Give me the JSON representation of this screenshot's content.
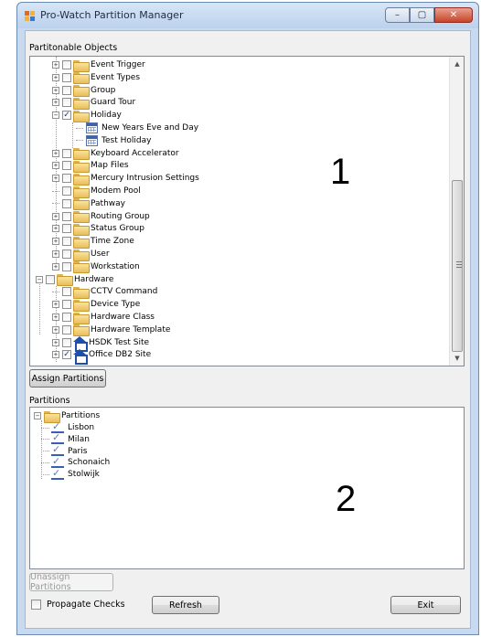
{
  "window": {
    "title": "Pro-Watch Partition Manager",
    "buttons": {
      "minimize": "–",
      "maximize": "▢",
      "close": "✕"
    }
  },
  "objects_panel": {
    "label": "Partitonable Objects",
    "items": [
      {
        "label": "Event Trigger",
        "expander": "+",
        "checked": false,
        "icon": "folder-icon"
      },
      {
        "label": "Event Types",
        "expander": "+",
        "checked": false,
        "icon": "folder-icon"
      },
      {
        "label": "Group",
        "expander": "+",
        "checked": false,
        "icon": "folder-icon"
      },
      {
        "label": "Guard Tour",
        "expander": "+",
        "checked": false,
        "icon": "folder-icon"
      },
      {
        "label": "Holiday",
        "expander": "−",
        "checked": true,
        "icon": "folder-icon"
      },
      {
        "label": "New Years Eve and Day",
        "expander": "",
        "checked": false,
        "icon": "calendar-icon"
      },
      {
        "label": "Test Holiday",
        "expander": "",
        "checked": false,
        "icon": "calendar-icon"
      },
      {
        "label": "Keyboard Accelerator",
        "expander": "+",
        "checked": false,
        "icon": "folder-icon"
      },
      {
        "label": "Map Files",
        "expander": "+",
        "checked": false,
        "icon": "folder-icon"
      },
      {
        "label": "Mercury Intrusion Settings",
        "expander": "+",
        "checked": false,
        "icon": "folder-icon"
      },
      {
        "label": "Modem Pool",
        "expander": "",
        "checked": false,
        "icon": "folder-icon"
      },
      {
        "label": "Pathway",
        "expander": "",
        "checked": false,
        "icon": "folder-icon"
      },
      {
        "label": "Routing Group",
        "expander": "+",
        "checked": false,
        "icon": "folder-icon"
      },
      {
        "label": "Status Group",
        "expander": "+",
        "checked": false,
        "icon": "folder-icon"
      },
      {
        "label": "Time Zone",
        "expander": "+",
        "checked": false,
        "icon": "folder-icon"
      },
      {
        "label": "User",
        "expander": "+",
        "checked": false,
        "icon": "folder-icon"
      },
      {
        "label": "Workstation",
        "expander": "+",
        "checked": false,
        "icon": "folder-icon"
      },
      {
        "label": "Hardware",
        "expander": "−",
        "checked": false,
        "icon": "folder-icon"
      },
      {
        "label": "CCTV Command",
        "expander": "",
        "checked": false,
        "icon": "folder-icon"
      },
      {
        "label": "Device Type",
        "expander": "+",
        "checked": false,
        "icon": "folder-icon"
      },
      {
        "label": "Hardware Class",
        "expander": "+",
        "checked": false,
        "icon": "folder-icon"
      },
      {
        "label": "Hardware Template",
        "expander": "+",
        "checked": false,
        "icon": "folder-icon"
      },
      {
        "label": "HSDK Test Site",
        "expander": "+",
        "checked": false,
        "icon": "site-icon"
      },
      {
        "label": "Office DB2 Site",
        "expander": "+",
        "checked": true,
        "icon": "site-icon"
      }
    ],
    "annotation": "1"
  },
  "assign_button": "Assign Partitions",
  "partitions_panel": {
    "label": "Partitions",
    "root": "Partitions",
    "items": [
      "Lisbon",
      "Milan",
      "Paris",
      "Schonaich",
      "Stolwijk"
    ],
    "annotation": "2"
  },
  "unassign_button": "Unassign Partitions",
  "propagate_checks": {
    "label": "Propagate Checks",
    "checked": false
  },
  "refresh_button": "Refresh",
  "exit_button": "Exit"
}
